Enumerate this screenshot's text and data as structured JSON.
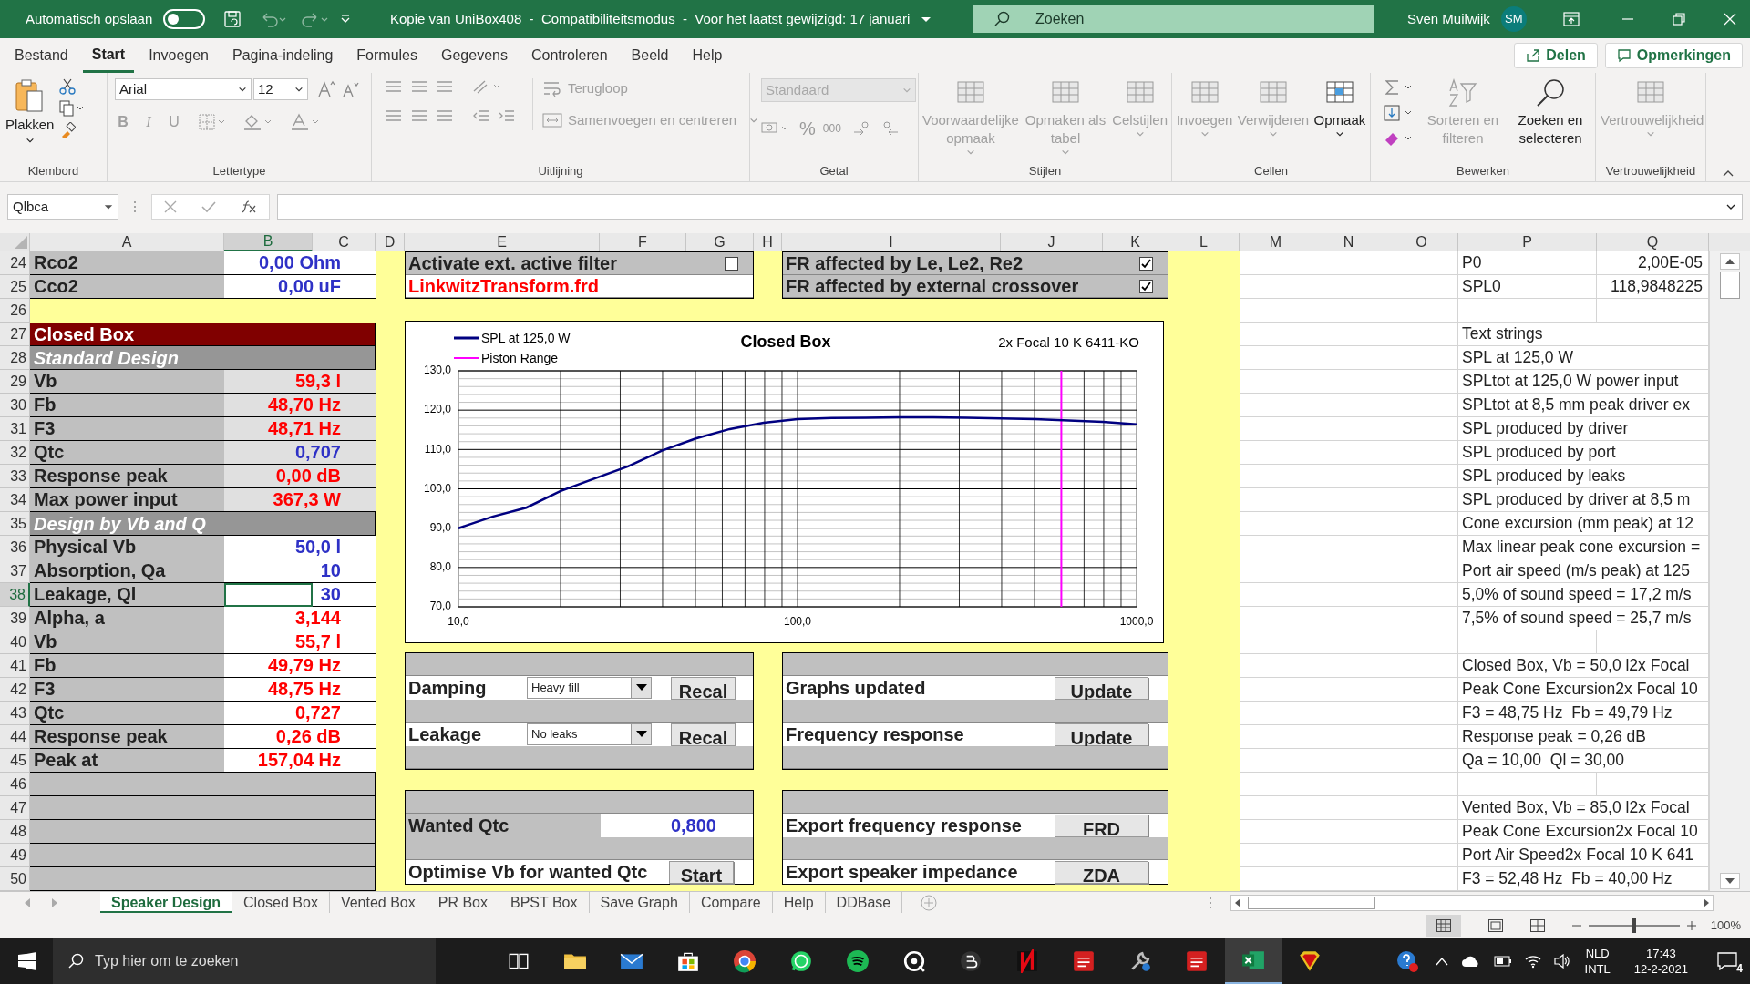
{
  "window": {
    "autosave_label": "Automatisch opslaan",
    "autosave_on": false,
    "title": "Kopie van UniBox408  -  Compatibiliteitsmodus  -  Voor het laatst gewijzigd: 17 januari",
    "search_placeholder": "Zoeken",
    "user_name": "Sven Muilwijk",
    "user_initials": "SM"
  },
  "menu_tabs": [
    {
      "label": "Bestand",
      "selected": false
    },
    {
      "label": "Start",
      "selected": true
    },
    {
      "label": "Invoegen",
      "selected": false
    },
    {
      "label": "Pagina-indeling",
      "selected": false
    },
    {
      "label": "Formules",
      "selected": false
    },
    {
      "label": "Gegevens",
      "selected": false
    },
    {
      "label": "Controleren",
      "selected": false
    },
    {
      "label": "Beeld",
      "selected": false
    },
    {
      "label": "Help",
      "selected": false
    }
  ],
  "share_buttons": [
    "Delen",
    "Opmerkingen"
  ],
  "ribbon": {
    "groups": [
      {
        "label": "Klembord",
        "kind": "clipboard",
        "buttons": [
          {
            "label": "Plakken",
            "disabled": false
          }
        ]
      },
      {
        "label": "Lettertype",
        "kind": "font",
        "font_name": "Arial",
        "font_size": "12",
        "style_buttons": [
          "B",
          "I",
          "U"
        ]
      },
      {
        "label": "Uitlijning",
        "kind": "alignment",
        "buttons": [
          {
            "label": "Terugloop",
            "disabled": true
          },
          {
            "label": "Samenvoegen en centreren",
            "disabled": true
          }
        ]
      },
      {
        "label": "Getal",
        "kind": "number",
        "format": "Standaard",
        "symbols": [
          "%",
          "000"
        ]
      },
      {
        "label": "Stijlen",
        "kind": "large",
        "buttons": [
          {
            "label": "Voorwaardelijke opmaak",
            "disabled": true
          },
          {
            "label": "Opmaken als tabel",
            "disabled": true
          },
          {
            "label": "Celstijlen",
            "disabled": true
          }
        ]
      },
      {
        "label": "Cellen",
        "kind": "large",
        "buttons": [
          {
            "label": "Invoegen",
            "disabled": true
          },
          {
            "label": "Verwijderen",
            "disabled": true
          },
          {
            "label": "Opmaak",
            "disabled": false
          }
        ]
      },
      {
        "label": "Bewerken",
        "kind": "editing",
        "buttons": [
          {
            "label": "Sorteren en filteren",
            "disabled": true
          },
          {
            "label": "Zoeken en selecteren",
            "disabled": false
          }
        ]
      },
      {
        "label": "Vertrouwelijkheid",
        "kind": "large",
        "buttons": [
          {
            "label": "Vertrouwelijkheid",
            "disabled": true
          }
        ]
      }
    ]
  },
  "formula_bar": {
    "name_box": "Qlbca"
  },
  "columns": [
    {
      "label": "A",
      "selected": false
    },
    {
      "label": "B",
      "selected": true
    },
    {
      "label": "C",
      "selected": false
    },
    {
      "label": "D",
      "selected": false
    },
    {
      "label": "E",
      "selected": false
    },
    {
      "label": "F",
      "selected": false
    },
    {
      "label": "G",
      "selected": false
    },
    {
      "label": "H",
      "selected": false
    },
    {
      "label": "I",
      "selected": false
    },
    {
      "label": "J",
      "selected": false
    },
    {
      "label": "K",
      "selected": false
    },
    {
      "label": "L",
      "selected": false
    },
    {
      "label": "M",
      "selected": false
    },
    {
      "label": "N",
      "selected": false
    },
    {
      "label": "O",
      "selected": false
    },
    {
      "label": "P",
      "selected": false
    },
    {
      "label": "Q",
      "selected": false
    }
  ],
  "row_numbers": [
    {
      "label": "24",
      "selected": false
    },
    {
      "label": "25",
      "selected": false
    },
    {
      "label": "26",
      "selected": false
    },
    {
      "label": "27",
      "selected": false
    },
    {
      "label": "28",
      "selected": false
    },
    {
      "label": "29",
      "selected": false
    },
    {
      "label": "30",
      "selected": false
    },
    {
      "label": "31",
      "selected": false
    },
    {
      "label": "32",
      "selected": false
    },
    {
      "label": "33",
      "selected": false
    },
    {
      "label": "34",
      "selected": false
    },
    {
      "label": "35",
      "selected": false
    },
    {
      "label": "36",
      "selected": false
    },
    {
      "label": "37",
      "selected": false
    },
    {
      "label": "38",
      "selected": true
    },
    {
      "label": "39",
      "selected": false
    },
    {
      "label": "40",
      "selected": false
    },
    {
      "label": "41",
      "selected": false
    },
    {
      "label": "42",
      "selected": false
    },
    {
      "label": "43",
      "selected": false
    },
    {
      "label": "44",
      "selected": false
    },
    {
      "label": "45",
      "selected": false
    },
    {
      "label": "46",
      "selected": false
    },
    {
      "label": "47",
      "selected": false
    },
    {
      "label": "48",
      "selected": false
    },
    {
      "label": "49",
      "selected": false
    },
    {
      "label": "50",
      "selected": false
    }
  ],
  "design_table": [
    {
      "kind": "field",
      "label": "Rco2",
      "value": "0,00 Ohm",
      "color": "#2e31c6",
      "shaded": false,
      "selected": false
    },
    {
      "kind": "field",
      "label": "Cco2",
      "value": "0,00 uF",
      "color": "#2e31c6",
      "shaded": false,
      "selected": false
    },
    {
      "kind": "gap"
    },
    {
      "kind": "title",
      "label": "Closed Box"
    },
    {
      "kind": "section",
      "label": "Standard Design"
    },
    {
      "kind": "field",
      "label": "Vb",
      "value": "59,3 l",
      "color": "#ff0000",
      "shaded": true,
      "selected": false
    },
    {
      "kind": "field",
      "label": "Fb",
      "value": "48,70 Hz",
      "color": "#ff0000",
      "shaded": true,
      "selected": false
    },
    {
      "kind": "field",
      "label": "F3",
      "value": "48,71 Hz",
      "color": "#ff0000",
      "shaded": true,
      "selected": false
    },
    {
      "kind": "field",
      "label": "Qtc",
      "value": "0,707",
      "color": "#2e31c6",
      "shaded": true,
      "selected": false
    },
    {
      "kind": "field",
      "label": "Response peak",
      "value": "0,00 dB",
      "color": "#ff0000",
      "shaded": true,
      "selected": false
    },
    {
      "kind": "field",
      "label": "Max power input",
      "value": "367,3 W",
      "color": "#ff0000",
      "shaded": true,
      "selected": false
    },
    {
      "kind": "section",
      "label": "Design by Vb and Q"
    },
    {
      "kind": "field",
      "label": "Physical Vb",
      "value": "50,0 l",
      "color": "#2e31c6",
      "shaded": false,
      "selected": false
    },
    {
      "kind": "field",
      "label": "Absorption, Qa",
      "value": "10",
      "color": "#2e31c6",
      "shaded": false,
      "selected": false
    },
    {
      "kind": "field",
      "label": "Leakage, Ql",
      "value": "30",
      "color": "#2e31c6",
      "shaded": false,
      "selected": true
    },
    {
      "kind": "field",
      "label": "Alpha, a",
      "value": "3,144",
      "color": "#ff0000",
      "shaded": false,
      "selected": false
    },
    {
      "kind": "field",
      "label": "Vb",
      "value": "55,7 l",
      "color": "#ff0000",
      "shaded": false,
      "selected": false
    },
    {
      "kind": "field",
      "label": "Fb",
      "value": "49,79 Hz",
      "color": "#ff0000",
      "shaded": false,
      "selected": false
    },
    {
      "kind": "field",
      "label": "F3",
      "value": "48,75 Hz",
      "color": "#ff0000",
      "shaded": false,
      "selected": false
    },
    {
      "kind": "field",
      "label": "Qtc",
      "value": "0,727",
      "color": "#ff0000",
      "shaded": false,
      "selected": false
    },
    {
      "kind": "field",
      "label": "Response peak",
      "value": "0,26 dB",
      "color": "#ff0000",
      "shaded": false,
      "selected": false
    },
    {
      "kind": "field",
      "label": "Peak at",
      "value": "157,04 Hz",
      "color": "#ff0000",
      "shaded": false,
      "selected": false
    },
    {
      "kind": "filler"
    },
    {
      "kind": "filler"
    },
    {
      "kind": "filler"
    },
    {
      "kind": "filler"
    },
    {
      "kind": "filler"
    }
  ],
  "panels": [
    {
      "rows": [
        {
          "kind": "check",
          "label": "Activate ext. active filter",
          "checked": false
        },
        {
          "kind": "file",
          "label": "LinkwitzTransform.frd"
        }
      ]
    },
    {
      "rows": [
        {
          "kind": "check",
          "label": "FR affected by Le, Le2, Re2",
          "checked": true
        },
        {
          "kind": "check",
          "label": "FR affected by external crossover",
          "checked": true
        }
      ]
    },
    {
      "rows": [
        {
          "kind": "blank"
        },
        {
          "kind": "dropdown",
          "label": "Damping",
          "value": "Heavy fill",
          "button": "Recal"
        },
        {
          "kind": "blank"
        },
        {
          "kind": "dropdown",
          "label": "Leakage",
          "value": "No leaks",
          "button": "Recal"
        },
        {
          "kind": "blank"
        }
      ]
    },
    {
      "rows": [
        {
          "kind": "blank"
        },
        {
          "kind": "button",
          "label": "Graphs updated",
          "button": "Update"
        },
        {
          "kind": "blank"
        },
        {
          "kind": "button",
          "label": "Frequency response",
          "button": "Update"
        },
        {
          "kind": "blank"
        }
      ]
    },
    {
      "rows": [
        {
          "kind": "blank"
        },
        {
          "kind": "value",
          "label": "Wanted Qtc",
          "value": "0,800"
        },
        {
          "kind": "blank"
        },
        {
          "kind": "button",
          "label": "Optimise Vb for wanted Qtc",
          "button": "Start"
        }
      ]
    },
    {
      "rows": [
        {
          "kind": "blank"
        },
        {
          "kind": "button",
          "label": "Export frequency response",
          "button": "FRD"
        },
        {
          "kind": "blank"
        },
        {
          "kind": "button",
          "label": "Export speaker impedance",
          "button": "ZDA"
        }
      ]
    }
  ],
  "chart": {
    "subtitle": "2x Focal 10 K 6411-KO",
    "chart_data": {
      "type": "line",
      "title": "Closed Box",
      "categories": [
        "10,0",
        null,
        null,
        null,
        null,
        null,
        null,
        null,
        null,
        null,
        "100,0",
        null,
        null,
        null,
        null,
        null,
        null,
        null,
        null,
        null,
        "1000,0"
      ],
      "series": [
        {
          "name": "SPL at 125,0 W",
          "color": "#000080",
          "values": [
            90,
            92.9,
            95.2,
            99.4,
            102.6,
            105.7,
            109.7,
            112.8,
            115.2,
            116.8,
            117.7,
            118.0,
            118.1,
            118.2,
            118.2,
            118.1,
            117.9,
            117.7,
            117.4,
            117.0,
            116.4
          ]
        }
      ],
      "ylim": [
        70,
        130
      ],
      "yticks": [
        {
          "value": 70,
          "label": "70,0"
        },
        {
          "value": 80,
          "label": "80,0"
        },
        {
          "value": 90,
          "label": "90,0"
        },
        {
          "value": 100,
          "label": "100,0"
        },
        {
          "value": 110,
          "label": "110,0"
        },
        {
          "value": 120,
          "label": "120,0"
        },
        {
          "value": 130,
          "label": "130,0"
        }
      ],
      "grid": true
    },
    "marker_legend": {
      "label": "Piston Range",
      "color": "#ff00ff"
    }
  },
  "text_columns": [
    {
      "p": "P0",
      "q": "2,00E-05"
    },
    {
      "p": "SPL0",
      "q": "118,9848225"
    },
    {},
    {
      "p": "Text strings"
    },
    {
      "p": "SPL at 125,0 W"
    },
    {
      "p": "SPLtot at 125,0 W power input"
    },
    {
      "p": "SPLtot at 8,5 mm peak driver ex"
    },
    {
      "p": "SPL produced by driver"
    },
    {
      "p": "SPL produced by port"
    },
    {
      "p": "SPL produced by leaks"
    },
    {
      "p": "SPL produced by driver at 8,5 m"
    },
    {
      "p": "Cone excursion (mm peak) at 12"
    },
    {
      "p": "Max linear peak cone excursion ="
    },
    {
      "p": "Port air speed (m/s peak) at 125"
    },
    {
      "p": "5,0% of sound speed = 17,2 m/s"
    },
    {
      "p": "7,5% of sound speed = 25,7 m/s"
    },
    {},
    {
      "p": "Closed Box, Vb = 50,0 l2x Focal"
    },
    {
      "p": "Peak Cone Excursion2x Focal 10"
    },
    {
      "p": "F3 = 48,75 Hz  Fb = 49,79 Hz"
    },
    {
      "p": "Response peak = 0,26 dB"
    },
    {
      "p": "Qa = 10,00  Ql = 30,00"
    },
    {},
    {
      "p": "Vented Box, Vb = 85,0 l2x Focal"
    },
    {
      "p": "Peak Cone Excursion2x Focal 10"
    },
    {
      "p": "Port Air Speed2x Focal 10 K 641"
    },
    {
      "p": "F3 = 52,48 Hz  Fb = 40,00 Hz"
    }
  ],
  "sheet_tabs": [
    {
      "label": "Speaker Design",
      "selected": true
    },
    {
      "label": "Closed Box",
      "selected": false
    },
    {
      "label": "Vented Box",
      "selected": false
    },
    {
      "label": "PR Box",
      "selected": false
    },
    {
      "label": "BPST Box",
      "selected": false
    },
    {
      "label": "Save Graph",
      "selected": false
    },
    {
      "label": "Compare",
      "selected": false
    },
    {
      "label": "Help",
      "selected": false
    },
    {
      "label": "DDBase",
      "selected": false
    }
  ],
  "status_bar": {
    "zoom": "100%",
    "zoom_slider": {
      "level": 0.5
    }
  },
  "taskbar": {
    "search_placeholder": "Typ hier om te zoeken",
    "apps": [
      {
        "kind": "task_view",
        "selected": false
      },
      {
        "kind": "folder",
        "selected": false
      },
      {
        "kind": "mail",
        "selected": false
      },
      {
        "kind": "store",
        "selected": false
      },
      {
        "kind": "browser",
        "selected": false
      },
      {
        "kind": "chat",
        "selected": false
      },
      {
        "kind": "music",
        "selected": false
      },
      {
        "kind": "ring",
        "selected": false
      },
      {
        "kind": "dark_circle",
        "selected": false
      },
      {
        "kind": "red_tile",
        "selected": false
      },
      {
        "kind": "red_doc",
        "selected": false
      },
      {
        "kind": "tool",
        "selected": false
      },
      {
        "kind": "red_doc",
        "selected": false
      },
      {
        "kind": "sheet",
        "selected": true
      },
      {
        "kind": "shield",
        "selected": false
      }
    ],
    "language": "NLD",
    "layout": "INTL",
    "time": "17:43",
    "date": "12-2-2021",
    "notifications": "4"
  }
}
